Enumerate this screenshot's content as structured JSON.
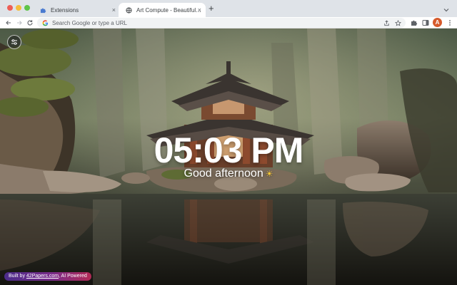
{
  "browser": {
    "tabs": [
      {
        "title": "Extensions",
        "icon": "puzzle-icon"
      },
      {
        "title": "Art Compute - Beautiful AI Art",
        "icon": "globe-icon"
      }
    ],
    "new_tab_label": "+",
    "close_label": "×",
    "omnibox": {
      "placeholder": "Search Google or type a URL",
      "value": ""
    },
    "profile_initial": "A",
    "profile_color": "#d65a2b"
  },
  "page": {
    "time": "05:03 PM",
    "greeting": "Good afternoon",
    "greeting_icon": "☀",
    "credit_prefix": "Built by ",
    "credit_link": "42Papers.com",
    "credit_suffix": ", AI Powered"
  },
  "colors": {
    "accent_gradient_start": "#4b2c8a",
    "accent_gradient_end": "#b22a55",
    "tab_bar": "#dfe3e8"
  }
}
